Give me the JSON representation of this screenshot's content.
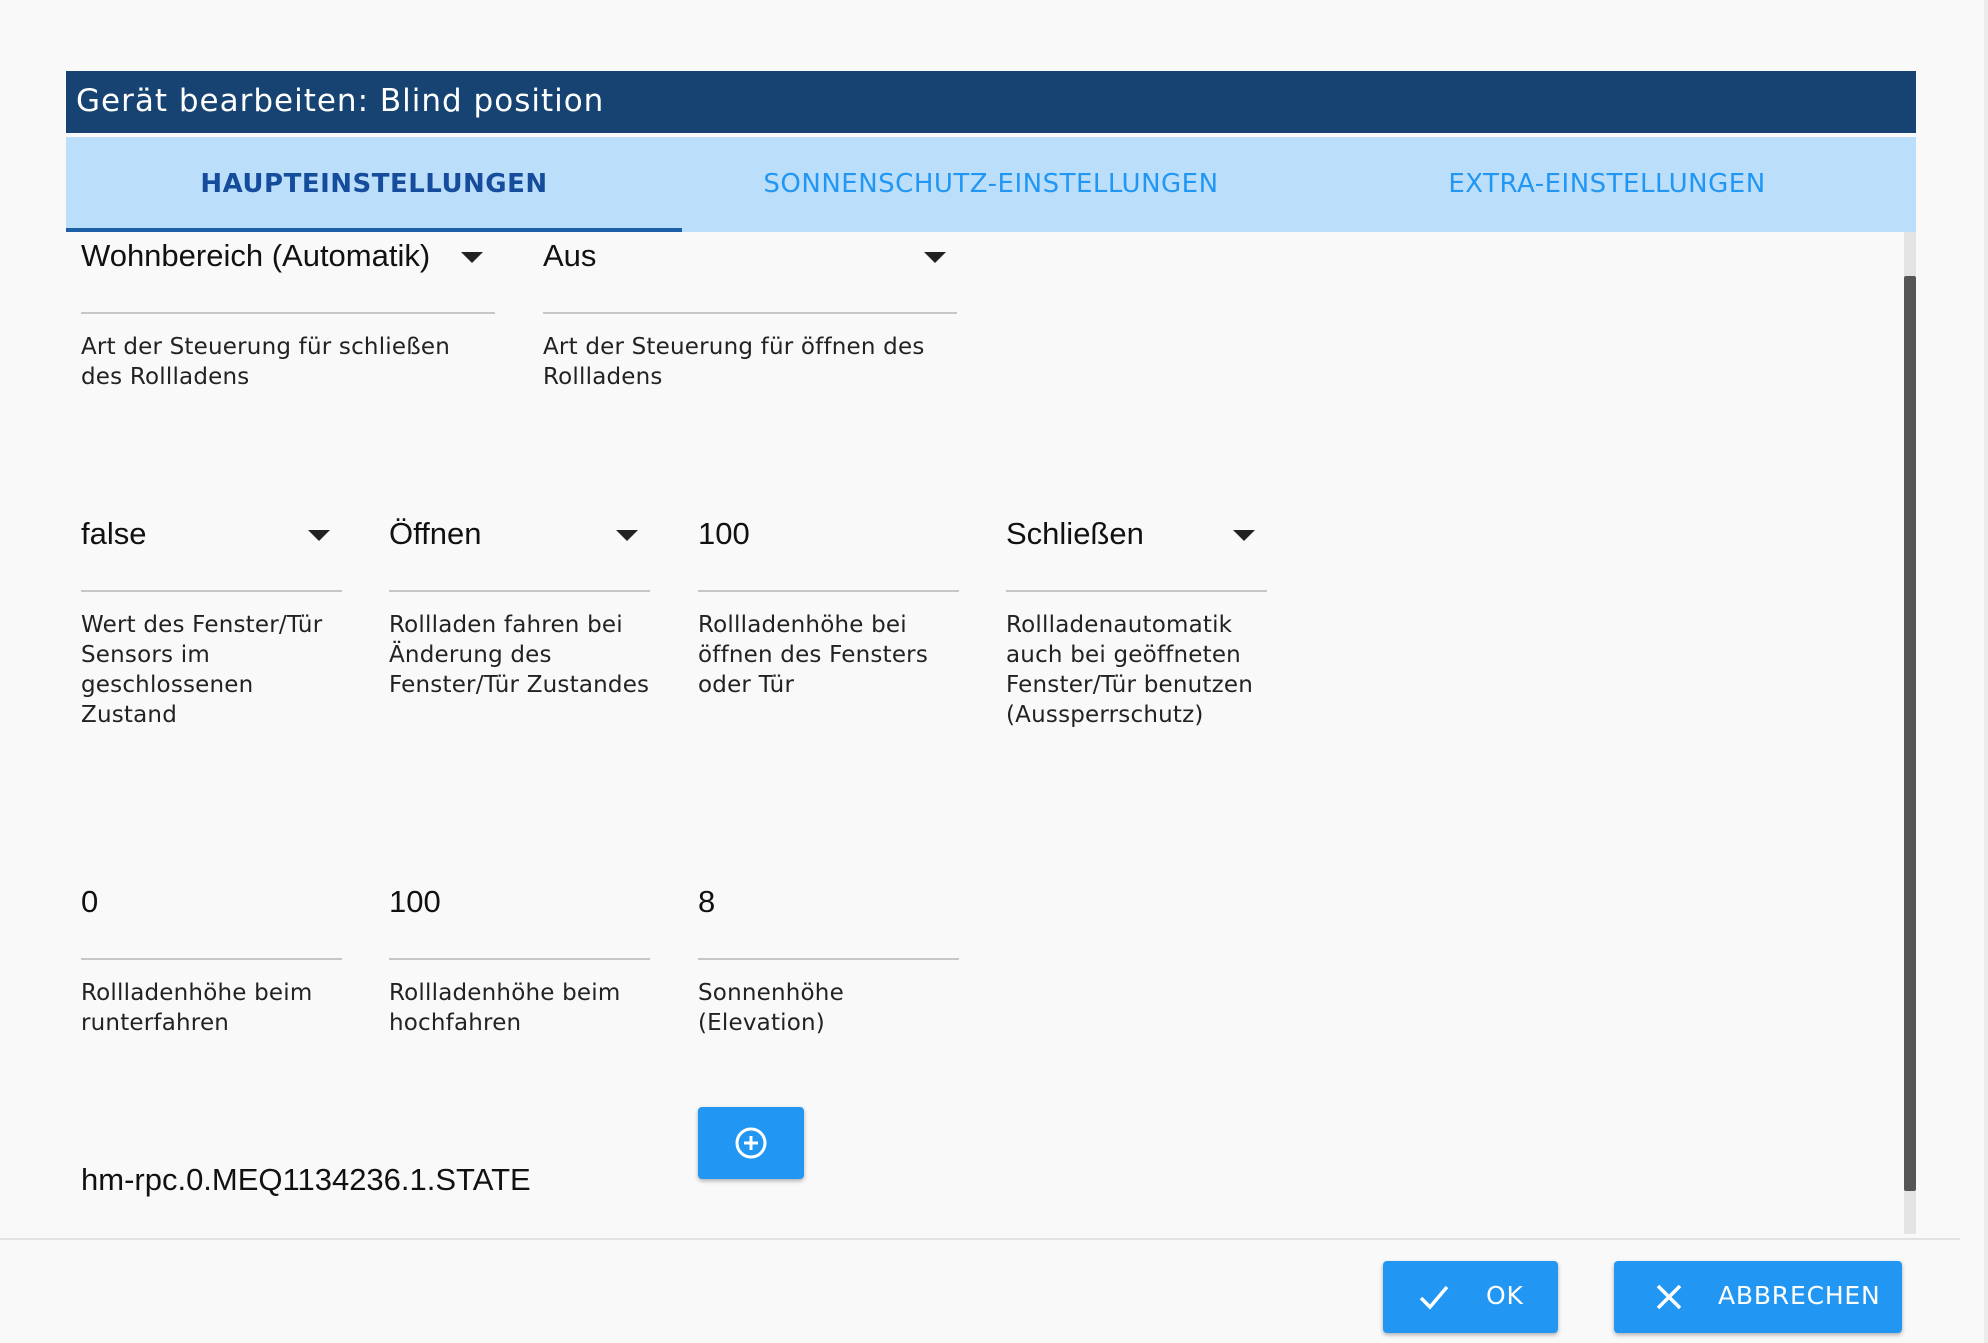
{
  "dialog": {
    "title": "Gerät bearbeiten: Blind position"
  },
  "tabs": [
    {
      "label": "HAUPTEINSTELLUNGEN",
      "active": true
    },
    {
      "label": "SONNENSCHUTZ-EINSTELLUNGEN",
      "active": false
    },
    {
      "label": "EXTRA-EINSTELLUNGEN",
      "active": false
    }
  ],
  "main": {
    "close_type": {
      "value": "Wohnbereich (Automatik)",
      "helper": "Art der Steuerung für schließen des Rollladens"
    },
    "open_type": {
      "value": "Aus",
      "helper": "Art der Steuerung für öffnen des Rollladens"
    },
    "sensor_value": {
      "value": "false",
      "helper": "Wert des Fenster/Tür Sensors im geschlossenen Zustand"
    },
    "sensor_action": {
      "value": "Öffnen",
      "helper": "Rollladen fahren bei Änderung des Fenster/Tür Zustandes"
    },
    "open_height": {
      "value": "100",
      "helper": "Rollladenhöhe bei öffnen des Fensters oder Tür"
    },
    "lockout": {
      "value": "Schließen",
      "helper": "Rollladenautomatik auch bei geöffneten Fenster/Tür benutzen (Aussperrschutz)"
    },
    "down_height": {
      "value": "0",
      "helper": "Rollladenhöhe beim runterfahren"
    },
    "up_height": {
      "value": "100",
      "helper": "Rollladenhöhe beim hochfahren"
    },
    "elevation": {
      "value": "8",
      "helper": "Sonnenhöhe (Elevation)"
    },
    "sensor_state": {
      "value": "hm-rpc.0.MEQ1134236.1.STATE"
    }
  },
  "footer": {
    "ok_label": "OK",
    "cancel_label": "ABBRECHEN"
  },
  "icons": {
    "add": "plus-circle-icon",
    "ok": "check-icon",
    "cancel": "close-icon",
    "dropdown": "chevron-down-icon"
  },
  "colors": {
    "title_bar": "#164371",
    "tab_bar": "#bbdefb",
    "tab_active": "#164c9c",
    "tab_inactive": "#2196f3",
    "button": "#2196f3"
  }
}
